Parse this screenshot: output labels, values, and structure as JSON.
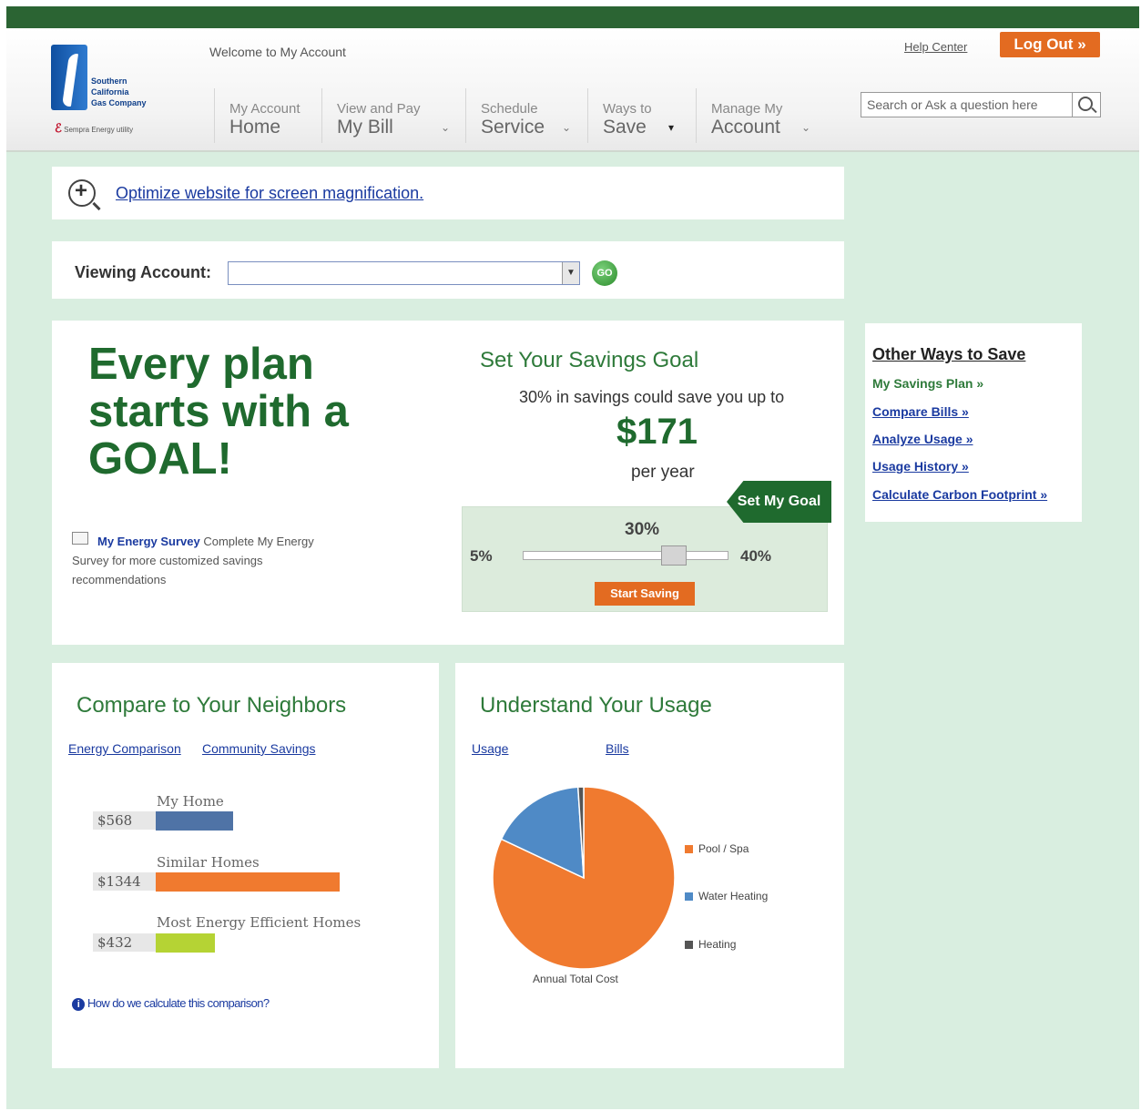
{
  "header": {
    "logo_text": [
      "Southern",
      "California",
      "Gas Company"
    ],
    "logo_sub": "Sempra Energy utility",
    "welcome": "Welcome to My Account",
    "help": "Help Center",
    "logout": "Log Out »",
    "search_placeholder": "Search or Ask a question here"
  },
  "nav": [
    {
      "small": "My Account",
      "large": "Home"
    },
    {
      "small": "View and Pay",
      "large": "My Bill"
    },
    {
      "small": "Schedule",
      "large": "Service"
    },
    {
      "small": "Ways to",
      "large": "Save"
    },
    {
      "small": "Manage My",
      "large": "Account"
    }
  ],
  "magnify": {
    "link": "Optimize website for screen magnification."
  },
  "account": {
    "label": "Viewing Account:",
    "selected": "",
    "go": "GO"
  },
  "goal": {
    "heading": "Every plan starts with a GOAL!",
    "survey_link": "My Energy Survey",
    "survey_text": " Complete My Energy Survey for more customized savings recommendations",
    "title": "Set Your Savings Goal",
    "subtitle": "30% in savings could save you up to",
    "amount": "$171",
    "per": "per year",
    "set_goal_button": "Set My Goal",
    "slider_value": "30%",
    "slider_min": "5%",
    "slider_max": "40%",
    "slider_fraction": 0.71,
    "start_button": "Start Saving"
  },
  "other_ways": {
    "title": "Other Ways to Save",
    "items": [
      "My Savings Plan »",
      "Compare Bills »",
      "Analyze Usage »",
      "Usage History »",
      "Calculate Carbon Footprint »"
    ]
  },
  "neighbors": {
    "title": "Compare to Your Neighbors",
    "tabs": [
      "Energy Comparison",
      "Community Savings"
    ],
    "rows": [
      {
        "label": "My Home",
        "value": "$568",
        "amount": 568,
        "color": "#4f73a6"
      },
      {
        "label": "Similar Homes",
        "value": "$1344",
        "amount": 1344,
        "color": "#f07a2f"
      },
      {
        "label": "Most Energy Efficient Homes",
        "value": "$432",
        "amount": 432,
        "color": "#b5d334"
      }
    ],
    "info": "How do we calculate this comparison?"
  },
  "usage": {
    "title": "Understand Your Usage",
    "tabs": [
      "Usage",
      "Bills"
    ],
    "caption": "Annual Total Cost"
  },
  "chart_data": {
    "type": "pie",
    "title": "",
    "xlabel": "Annual Total Cost",
    "categories": [
      "Pool / Spa",
      "Water Heating",
      "Heating"
    ],
    "values": [
      82,
      17,
      1
    ],
    "colors": [
      "#f07a2f",
      "#4f8ac6",
      "#555555"
    ],
    "legend": "right"
  },
  "colors": {
    "brand_green": "#2b6433",
    "accent_orange": "#e36b21",
    "link_blue": "#1a3aa0",
    "page_bg": "#d9eee0"
  }
}
